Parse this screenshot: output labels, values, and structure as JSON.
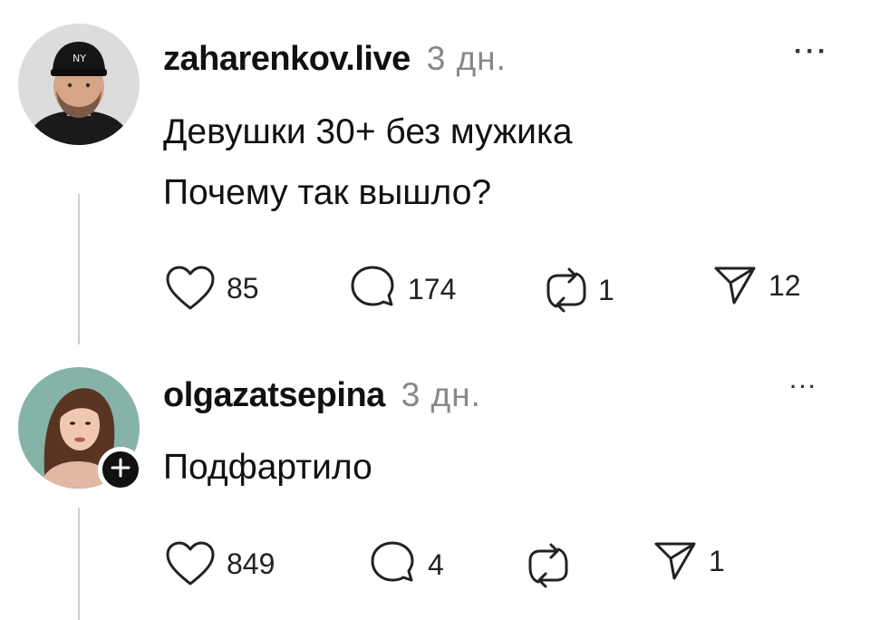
{
  "posts": [
    {
      "username": "zaharenkov.live",
      "time": "3 дн.",
      "more": "···",
      "lines": [
        "Девушки 30+ без мужика",
        "Почему так вышло?"
      ],
      "likes": "85",
      "comments": "174",
      "reposts": "1",
      "shares": "12",
      "avatar_icon": "avatar-man-cap"
    },
    {
      "username": "olgazatsepina",
      "time": "3 дн.",
      "more": "···",
      "lines": [
        "Подфартило"
      ],
      "likes": "849",
      "comments": "4",
      "reposts": "",
      "shares": "1",
      "avatar_icon": "avatar-woman"
    }
  ],
  "colors": {
    "text": "#111111",
    "muted": "#888888",
    "line": "#cfcfcf",
    "badge": "#111111"
  }
}
